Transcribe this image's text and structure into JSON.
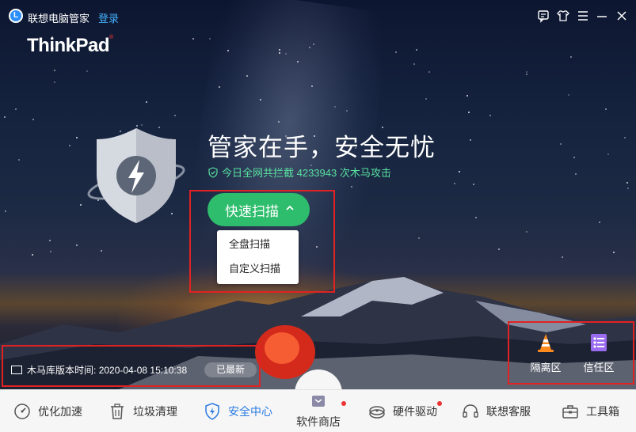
{
  "window": {
    "app_title": "联想电脑管家",
    "login_label": "登录",
    "brand": "ThinkPad",
    "brand_mark": "®",
    "icons": [
      "feedback-icon",
      "skin-icon",
      "menu-icon",
      "minimize-icon",
      "close-icon"
    ]
  },
  "hero": {
    "headline": "管家在手，安全无忧",
    "intercept_text": "今日全网共拦截 4233943 次木马攻击"
  },
  "scan": {
    "button_label": "快速扫描",
    "options": [
      "全盘扫描",
      "自定义扫描"
    ]
  },
  "version": {
    "label": "木马库版本时间:",
    "datetime": "2020-04-08 15:10:38",
    "status_badge": "已最新"
  },
  "quick_actions": [
    {
      "label": "隔离区",
      "icon": "traffic-cone-icon"
    },
    {
      "label": "信任区",
      "icon": "checklist-icon"
    }
  ],
  "nav": {
    "items": [
      {
        "label": "优化加速",
        "icon": "speedometer-icon",
        "active": false
      },
      {
        "label": "垃圾清理",
        "icon": "trash-icon",
        "active": false
      },
      {
        "label": "安全中心",
        "icon": "shield-icon",
        "active": true
      },
      {
        "label": "软件商店",
        "icon": "store-icon",
        "active": false,
        "dot": true
      },
      {
        "label": "硬件驱动",
        "icon": "driver-icon",
        "active": false,
        "dot": true
      },
      {
        "label": "联想客服",
        "icon": "headset-icon",
        "active": false
      },
      {
        "label": "工具箱",
        "icon": "toolbox-icon",
        "active": false
      }
    ]
  },
  "colors": {
    "accent_green": "#2ebd6c",
    "active_blue": "#2a7ae2",
    "intercept_text": "#57e0a0",
    "highlight_red": "#e12222"
  }
}
